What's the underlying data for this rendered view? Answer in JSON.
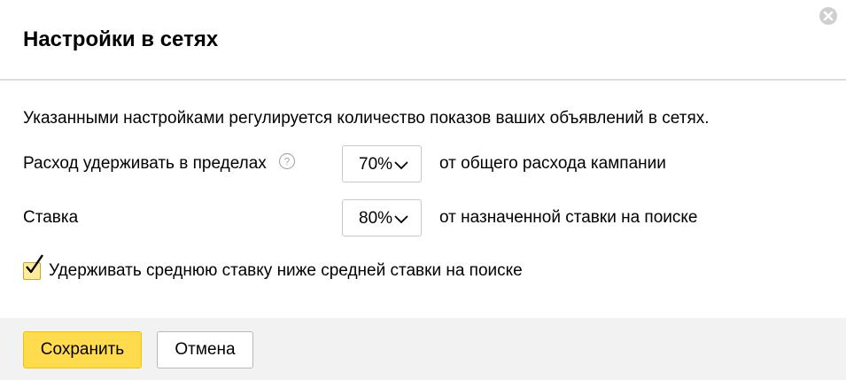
{
  "dialog": {
    "title": "Настройки в сетях",
    "close_icon": "close-icon"
  },
  "intro": {
    "text": "Указанными настройками регулируется количество показов ваших объявлений в сетях."
  },
  "settings": [
    {
      "label": "Расход удерживать в пределах",
      "help_icon": "question-circle-icon",
      "select_value": "70%",
      "suffix": "от общего расхода кампании"
    },
    {
      "label": "Ставка",
      "select_value": "80%",
      "suffix": "от назначенной ставки на поиске"
    }
  ],
  "checkbox": {
    "label": "Удерживать среднюю ставку ниже средней ставки на поиске",
    "checked": true
  },
  "footer": {
    "save_label": "Сохранить",
    "cancel_label": "Отмена"
  },
  "colors": {
    "accent": "#ffdb4d",
    "checkbox_fill": "#ffeba0",
    "footer_bg": "#f2f2f2",
    "divider": "#dcdcdc"
  }
}
